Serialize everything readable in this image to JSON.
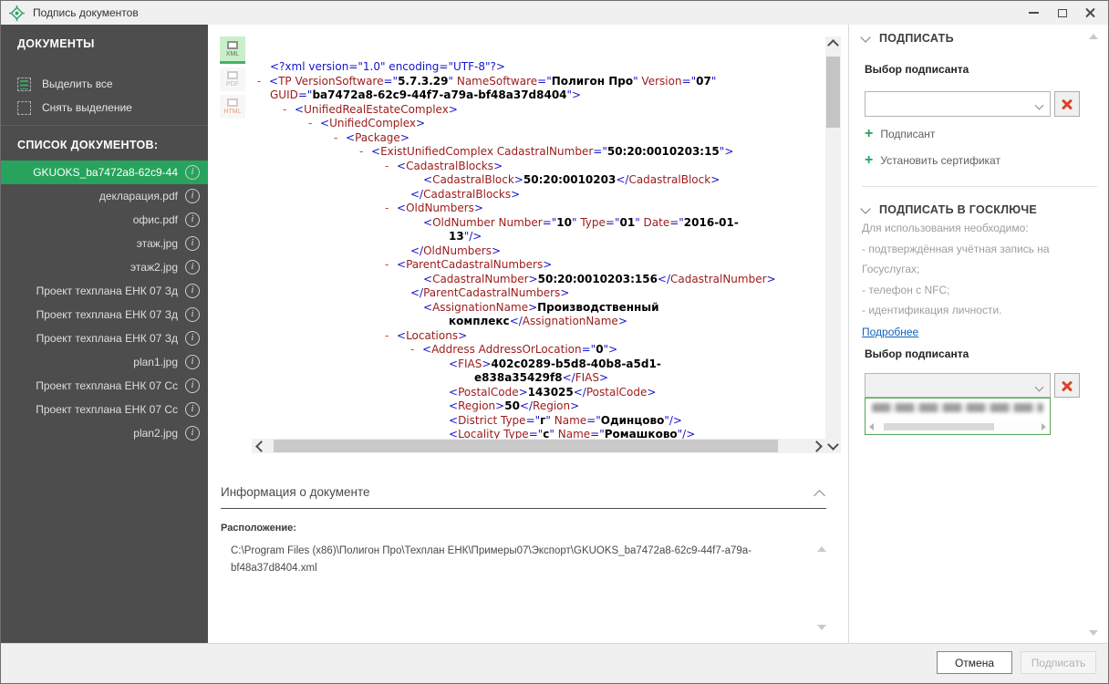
{
  "window": {
    "title": "Подпись документов"
  },
  "titlebar_icons": {
    "app": "crosshair-target-icon",
    "minimize": "minimize-icon",
    "maximize": "maximize-icon",
    "close": "close-icon"
  },
  "sidebar": {
    "section1_title": "ДОКУМЕНТЫ",
    "actions": [
      {
        "label": "Выделить все",
        "icon": "select-all-icon"
      },
      {
        "label": "Снять выделение",
        "icon": "deselect-icon"
      }
    ],
    "section2_title": "СПИСОК ДОКУМЕНТОВ:",
    "documents": [
      {
        "name": "GKUOKS_ba7472a8-62c9-44",
        "selected": true
      },
      {
        "name": "декларация.pdf",
        "selected": false
      },
      {
        "name": "офис.pdf",
        "selected": false
      },
      {
        "name": "этаж.jpg",
        "selected": false
      },
      {
        "name": "этаж2.jpg",
        "selected": false
      },
      {
        "name": "Проект техплана ЕНК 07 Зд",
        "selected": false
      },
      {
        "name": "Проект техплана ЕНК 07 Зд",
        "selected": false
      },
      {
        "name": "Проект техплана ЕНК 07 Зд",
        "selected": false
      },
      {
        "name": "plan1.jpg",
        "selected": false
      },
      {
        "name": "Проект техплана ЕНК 07 Сс",
        "selected": false
      },
      {
        "name": "Проект техплана ЕНК 07 Сс",
        "selected": false
      },
      {
        "name": "plan2.jpg",
        "selected": false
      }
    ]
  },
  "viewer": {
    "format_buttons": [
      {
        "label": "XML",
        "active": true
      },
      {
        "label": "PDF",
        "active": false
      },
      {
        "label": "HTML",
        "active": false
      }
    ],
    "xml_lines": [
      {
        "ind": 1,
        "t": [
          [
            "p",
            "<?xml version=\"1.0\" encoding=\"UTF-8\"?>"
          ]
        ]
      },
      {
        "m": 1,
        "ind": 0,
        "t": [
          [
            "p",
            "<"
          ],
          [
            "e",
            "TP"
          ],
          [
            "e",
            " VersionSoftware"
          ],
          [
            "p",
            "=\""
          ],
          [
            "v",
            "5.7.3.29"
          ],
          [
            "p",
            "\""
          ],
          [
            "e",
            " NameSoftware"
          ],
          [
            "p",
            "=\""
          ],
          [
            "v",
            "Полигон Про"
          ],
          [
            "p",
            "\""
          ],
          [
            "e",
            " Version"
          ],
          [
            "p",
            "=\""
          ],
          [
            "v",
            "07"
          ],
          [
            "p",
            "\""
          ]
        ]
      },
      {
        "ind": 1,
        "t": [
          [
            "e",
            "GUID"
          ],
          [
            "p",
            "=\""
          ],
          [
            "v",
            "ba7472a8-62c9-44f7-a79a-bf48a37d8404"
          ],
          [
            "p",
            "\">"
          ]
        ]
      },
      {
        "m": 1,
        "ind": 2,
        "t": [
          [
            "p",
            "<"
          ],
          [
            "e",
            "UnifiedRealEstateComplex"
          ],
          [
            "p",
            ">"
          ]
        ]
      },
      {
        "m": 1,
        "ind": 4,
        "t": [
          [
            "p",
            "<"
          ],
          [
            "e",
            "UnifiedComplex"
          ],
          [
            "p",
            ">"
          ]
        ]
      },
      {
        "m": 1,
        "ind": 6,
        "t": [
          [
            "p",
            "<"
          ],
          [
            "e",
            "Package"
          ],
          [
            "p",
            ">"
          ]
        ]
      },
      {
        "m": 1,
        "ind": 8,
        "t": [
          [
            "p",
            "<"
          ],
          [
            "e",
            "ExistUnifiedComplex"
          ],
          [
            "e",
            " CadastralNumber"
          ],
          [
            "p",
            "=\""
          ],
          [
            "v",
            "50:20:0010203:15"
          ],
          [
            "p",
            "\">"
          ]
        ]
      },
      {
        "m": 1,
        "ind": 10,
        "t": [
          [
            "p",
            "<"
          ],
          [
            "e",
            "CadastralBlocks"
          ],
          [
            "p",
            ">"
          ]
        ]
      },
      {
        "ind": 13,
        "t": [
          [
            "p",
            "<"
          ],
          [
            "e",
            "CadastralBlock"
          ],
          [
            "p",
            ">"
          ],
          [
            "v",
            "50:20:0010203"
          ],
          [
            "p",
            "</"
          ],
          [
            "e",
            "CadastralBlock"
          ],
          [
            "p",
            ">"
          ]
        ]
      },
      {
        "ind": 12,
        "t": [
          [
            "p",
            "</"
          ],
          [
            "e",
            "CadastralBlocks"
          ],
          [
            "p",
            ">"
          ]
        ]
      },
      {
        "m": 1,
        "ind": 10,
        "t": [
          [
            "p",
            "<"
          ],
          [
            "e",
            "OldNumbers"
          ],
          [
            "p",
            ">"
          ]
        ]
      },
      {
        "ind": 13,
        "t": [
          [
            "p",
            "<"
          ],
          [
            "e",
            "OldNumber"
          ],
          [
            "e",
            " Number"
          ],
          [
            "p",
            "=\""
          ],
          [
            "v",
            "10"
          ],
          [
            "p",
            "\""
          ],
          [
            "e",
            " Type"
          ],
          [
            "p",
            "=\""
          ],
          [
            "v",
            "01"
          ],
          [
            "p",
            "\""
          ],
          [
            "e",
            " Date"
          ],
          [
            "p",
            "=\""
          ],
          [
            "v",
            "2016-01-"
          ]
        ]
      },
      {
        "ind": 15,
        "t": [
          [
            "v",
            "13"
          ],
          [
            "p",
            "\"/>"
          ]
        ]
      },
      {
        "ind": 12,
        "t": [
          [
            "p",
            "</"
          ],
          [
            "e",
            "OldNumbers"
          ],
          [
            "p",
            ">"
          ]
        ]
      },
      {
        "m": 1,
        "ind": 10,
        "t": [
          [
            "p",
            "<"
          ],
          [
            "e",
            "ParentCadastralNumbers"
          ],
          [
            "p",
            ">"
          ]
        ]
      },
      {
        "ind": 13,
        "t": [
          [
            "p",
            "<"
          ],
          [
            "e",
            "CadastralNumber"
          ],
          [
            "p",
            ">"
          ],
          [
            "v",
            "50:20:0010203:156"
          ],
          [
            "p",
            "</"
          ],
          [
            "e",
            "CadastralNumber"
          ],
          [
            "p",
            ">"
          ]
        ]
      },
      {
        "ind": 12,
        "t": [
          [
            "p",
            "</"
          ],
          [
            "e",
            "ParentCadastralNumbers"
          ],
          [
            "p",
            ">"
          ]
        ]
      },
      {
        "ind": 13,
        "t": [
          [
            "p",
            "<"
          ],
          [
            "e",
            "AssignationName"
          ],
          [
            "p",
            ">"
          ],
          [
            "v",
            "Производственный"
          ]
        ]
      },
      {
        "ind": 15,
        "t": [
          [
            "v",
            "комплекс"
          ],
          [
            "p",
            "</"
          ],
          [
            "e",
            "AssignationName"
          ],
          [
            "p",
            ">"
          ]
        ]
      },
      {
        "m": 1,
        "ind": 10,
        "t": [
          [
            "p",
            "<"
          ],
          [
            "e",
            "Locations"
          ],
          [
            "p",
            ">"
          ]
        ]
      },
      {
        "m": 1,
        "ind": 12,
        "t": [
          [
            "p",
            "<"
          ],
          [
            "e",
            "Address"
          ],
          [
            "e",
            " AddressOrLocation"
          ],
          [
            "p",
            "=\""
          ],
          [
            "v",
            "0"
          ],
          [
            "p",
            "\">"
          ]
        ]
      },
      {
        "ind": 15,
        "t": [
          [
            "p",
            "<"
          ],
          [
            "e",
            "FIAS"
          ],
          [
            "p",
            ">"
          ],
          [
            "v",
            "402c0289-b5d8-40b8-a5d1-"
          ]
        ]
      },
      {
        "ind": 17,
        "t": [
          [
            "v",
            "e838a35429f8"
          ],
          [
            "p",
            "</"
          ],
          [
            "e",
            "FIAS"
          ],
          [
            "p",
            ">"
          ]
        ]
      },
      {
        "ind": 15,
        "t": [
          [
            "p",
            "<"
          ],
          [
            "e",
            "PostalCode"
          ],
          [
            "p",
            ">"
          ],
          [
            "v",
            "143025"
          ],
          [
            "p",
            "</"
          ],
          [
            "e",
            "PostalCode"
          ],
          [
            "p",
            ">"
          ]
        ]
      },
      {
        "ind": 15,
        "t": [
          [
            "p",
            "<"
          ],
          [
            "e",
            "Region"
          ],
          [
            "p",
            ">"
          ],
          [
            "v",
            "50"
          ],
          [
            "p",
            "</"
          ],
          [
            "e",
            "Region"
          ],
          [
            "p",
            ">"
          ]
        ]
      },
      {
        "ind": 15,
        "t": [
          [
            "p",
            "<"
          ],
          [
            "e",
            "District"
          ],
          [
            "e",
            " Type"
          ],
          [
            "p",
            "=\""
          ],
          [
            "v",
            "г"
          ],
          [
            "p",
            "\""
          ],
          [
            "e",
            " Name"
          ],
          [
            "p",
            "=\""
          ],
          [
            "v",
            "Одинцово"
          ],
          [
            "p",
            "\"/>"
          ]
        ]
      },
      {
        "ind": 15,
        "t": [
          [
            "p",
            "<"
          ],
          [
            "e",
            "Locality"
          ],
          [
            "e",
            " Type"
          ],
          [
            "p",
            "=\""
          ],
          [
            "v",
            "с"
          ],
          [
            "p",
            "\""
          ],
          [
            "e",
            " Name"
          ],
          [
            "p",
            "=\""
          ],
          [
            "v",
            "Ромашково"
          ],
          [
            "p",
            "\"/>"
          ]
        ]
      }
    ]
  },
  "info_panel": {
    "title": "Информация о документе",
    "location_label": "Расположение:",
    "location_value": "C:\\Program Files (x86)\\Полигон Про\\Техплан ЕНК\\Примеры07\\Экспорт\\GKUOKS_ba7472a8-62c9-44f7-a79a-bf48a37d8404.xml"
  },
  "sign_panel": {
    "section1": {
      "title": "ПОДПИСАТЬ",
      "signer_label": "Выбор подписанта",
      "signer_value": "",
      "add_signer_label": "Подписант",
      "install_cert_label": "Установить сертификат"
    },
    "section2": {
      "title": "ПОДПИСАТЬ В ГОСКЛЮЧЕ",
      "requirement_lines": [
        "Для использования необходимо:",
        "- подтверждённая учётная запись на",
        "Госуслугах;",
        "- телефон с NFC;",
        "- идентификация личности."
      ],
      "details_link": "Подробнее",
      "signer_label": "Выбор подписанта",
      "signer_value": "",
      "dropdown_item_redacted": true
    }
  },
  "footer": {
    "cancel_label": "Отмена",
    "sign_label": "Подписать"
  },
  "colors": {
    "accent_green": "#27a35d",
    "sidebar_bg": "#4d4d4d",
    "xml_punct": "#1414cc",
    "xml_name": "#9c1a1a",
    "xml_value": "#000000",
    "xml_marker": "#d23b3b",
    "link_blue": "#0b63c0",
    "clear_red": "#d94427",
    "active_format_bg": "#c9efca"
  }
}
